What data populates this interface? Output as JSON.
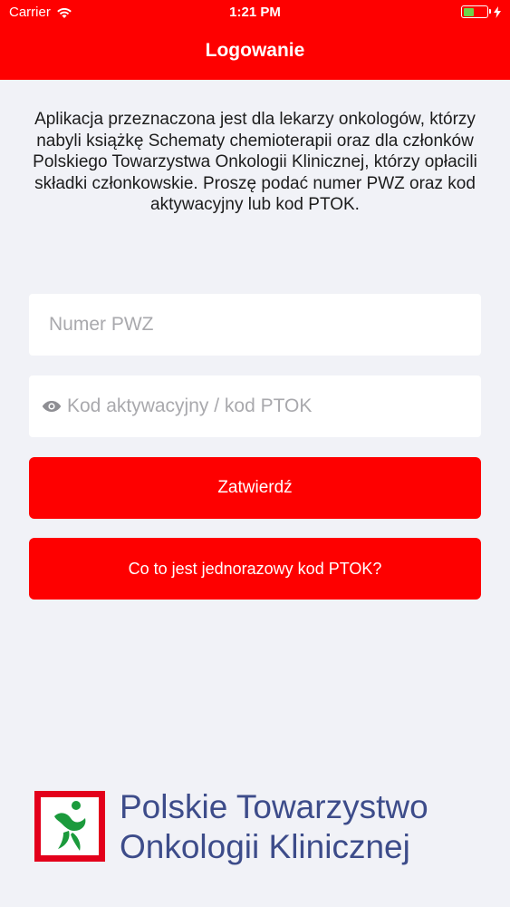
{
  "status_bar": {
    "carrier": "Carrier",
    "time": "1:21 PM",
    "icons": [
      "wifi-icon",
      "battery-icon",
      "charging-icon"
    ]
  },
  "header": {
    "title": "Logowanie",
    "color": "#fe0000"
  },
  "intro": {
    "text": "Aplikacja przeznaczona jest dla lekarzy onkologów, którzy nabyli książkę Schematy chemioterapii oraz dla członków Polskiego Towarzystwa Onkologii Klinicznej, którzy opłacili składki członkowskie. Proszę podać numer PWZ oraz kod aktywacyjny lub kod PTOK."
  },
  "form": {
    "pwz": {
      "placeholder": "Numer PWZ",
      "value": ""
    },
    "code": {
      "placeholder": "Kod aktywacyjny / kod PTOK",
      "value": ""
    },
    "submit_label": "Zatwierdź",
    "info_label": "Co to jest jednorazowy kod PTOK?"
  },
  "logo": {
    "line1": "Polskie Towarzystwo",
    "line2": "Onkologii Klinicznej"
  },
  "colors": {
    "accent": "#fe0000",
    "background": "#f1f2f7",
    "logo_text": "#3d4c8a",
    "logo_green": "#1b9a3c"
  }
}
